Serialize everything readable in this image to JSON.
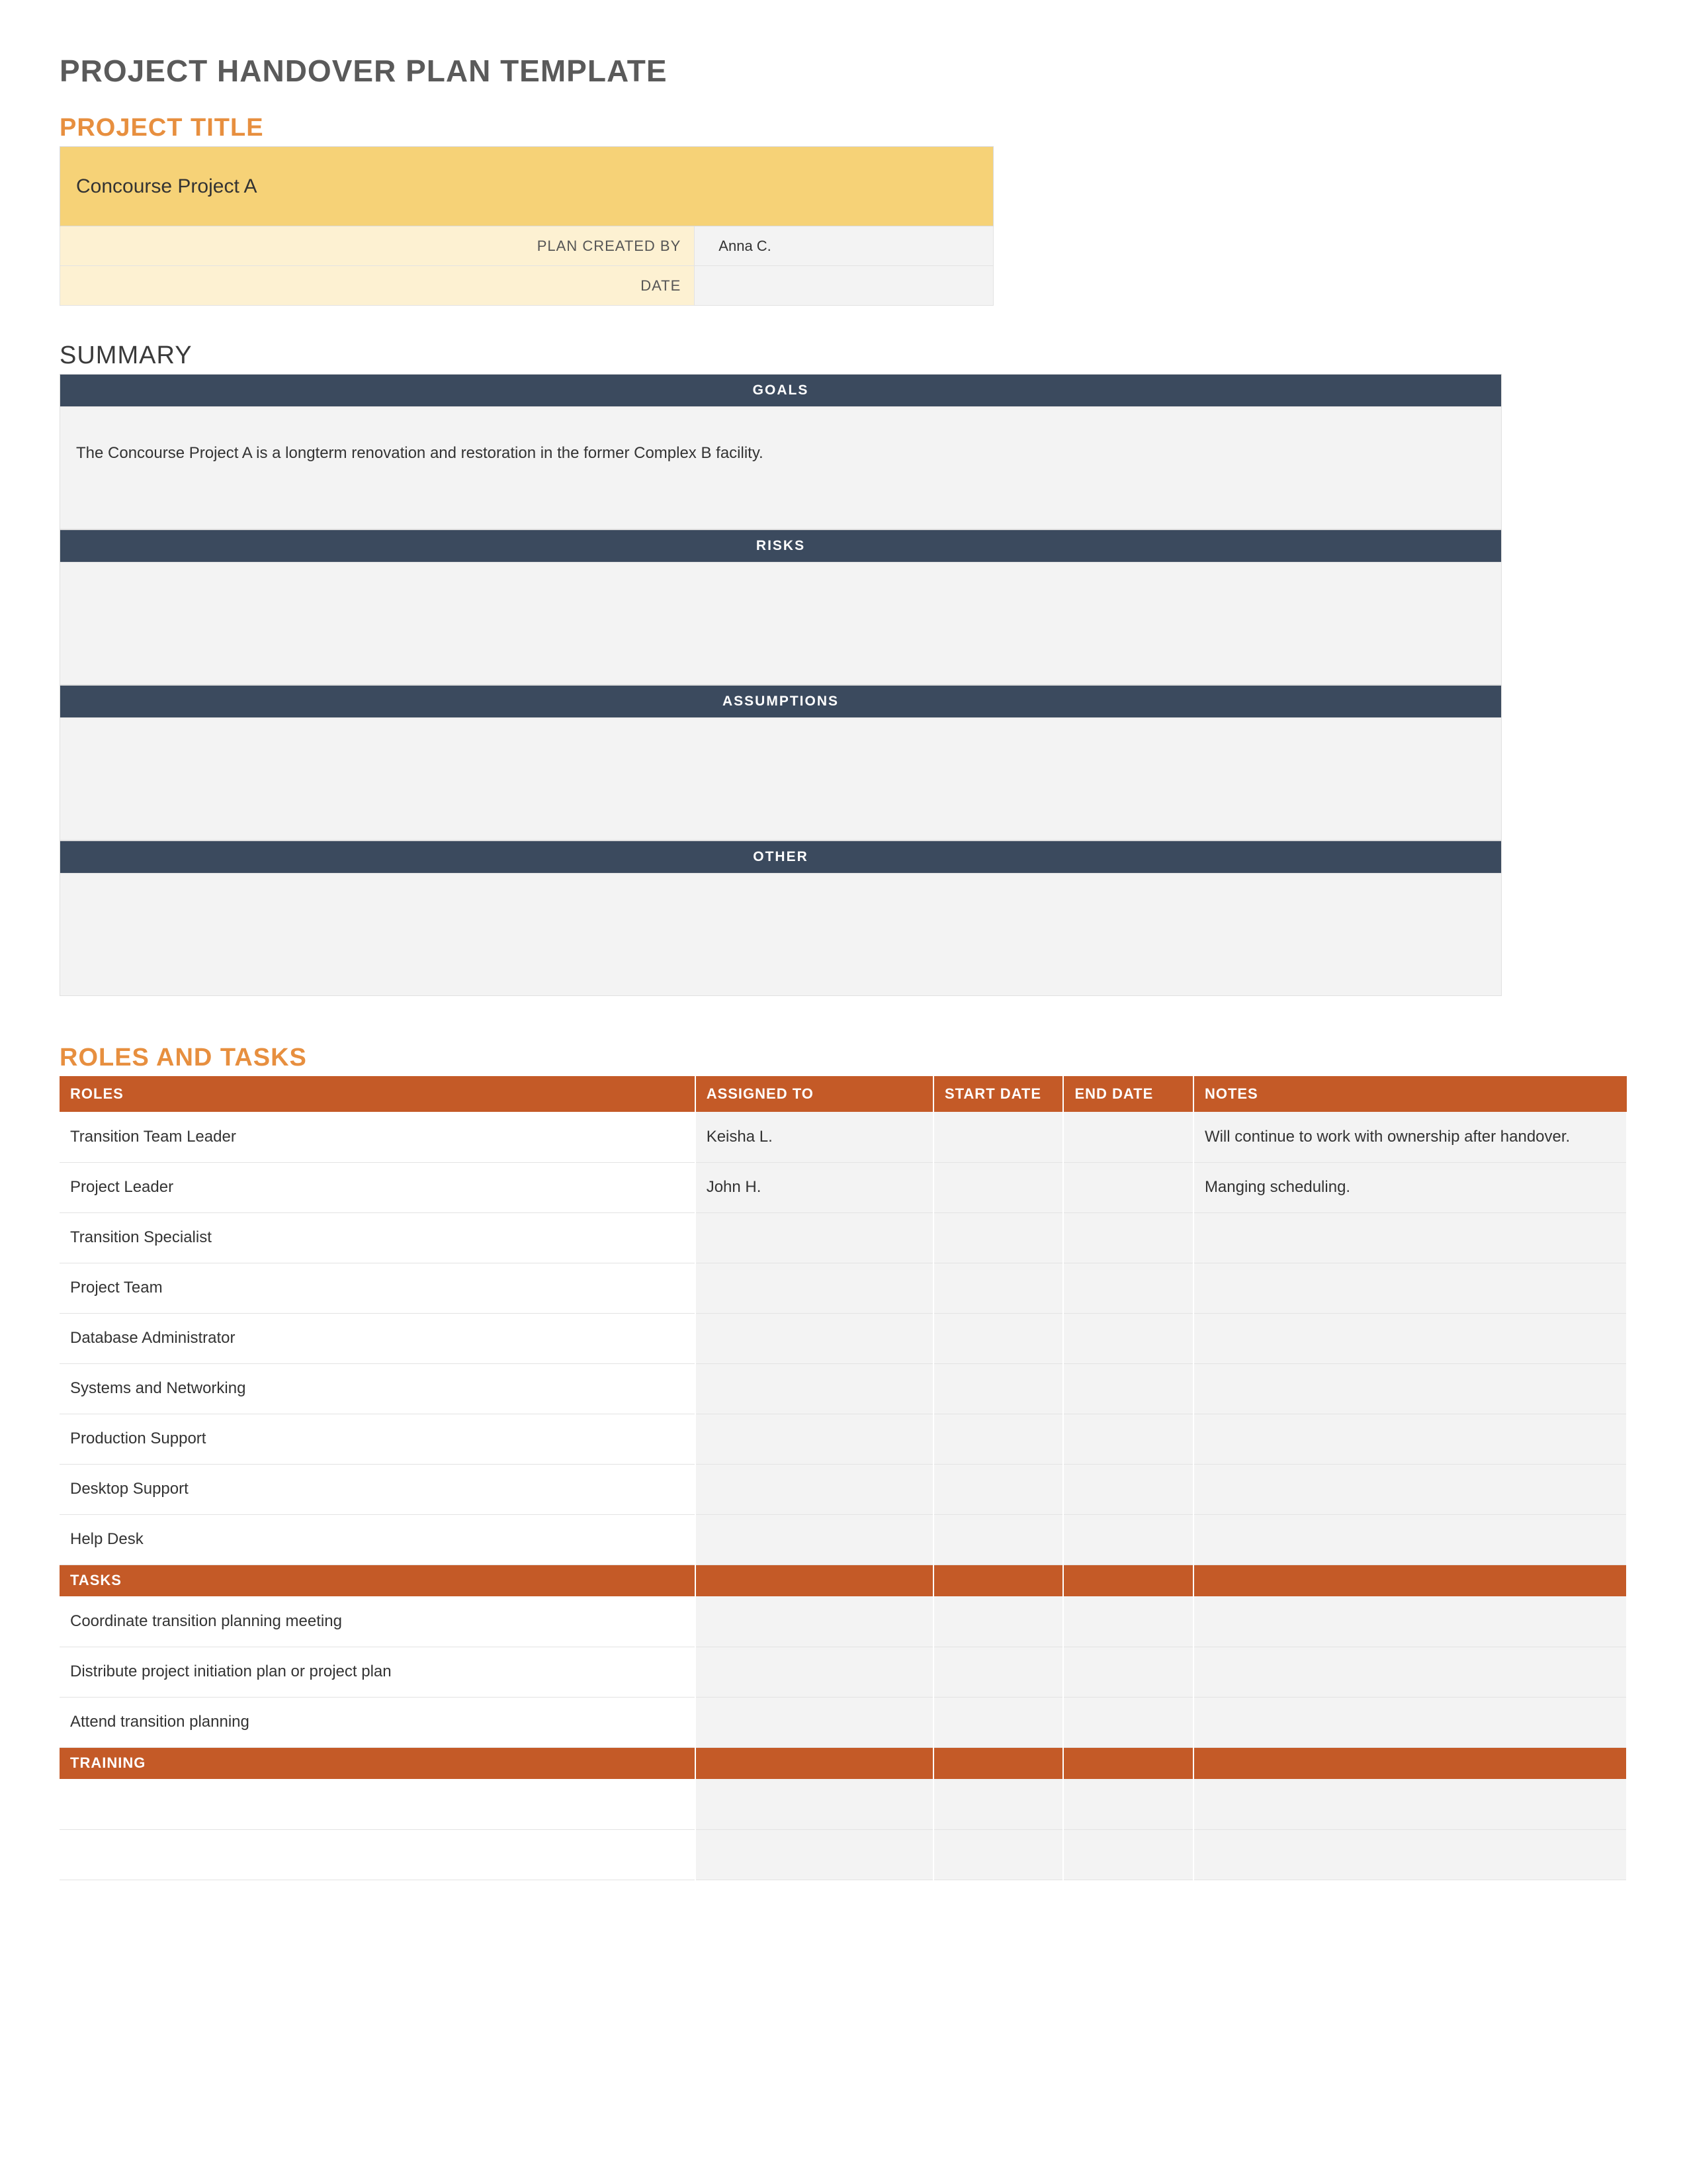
{
  "doc_title": "PROJECT HANDOVER PLAN TEMPLATE",
  "project_title_section": {
    "heading": "PROJECT TITLE",
    "project_name": "Concourse Project A",
    "created_by_label": "PLAN CREATED BY",
    "created_by_value": "Anna C.",
    "date_label": "DATE",
    "date_value": ""
  },
  "summary": {
    "heading": "SUMMARY",
    "goals_label": "GOALS",
    "goals_body": "The Concourse Project A is a longterm renovation and restoration in the former Complex B facility.",
    "risks_label": "RISKS",
    "risks_body": "",
    "assumptions_label": "ASSUMPTIONS",
    "assumptions_body": "",
    "other_label": "OTHER",
    "other_body": ""
  },
  "roles_tasks": {
    "heading": "ROLES AND TASKS",
    "columns": {
      "roles": "ROLES",
      "assigned": "ASSIGNED TO",
      "start": "START DATE",
      "end": "END DATE",
      "notes": "NOTES"
    },
    "roles": [
      {
        "role": "Transition Team Leader",
        "assigned": "Keisha L.",
        "start": "",
        "end": "",
        "notes": "Will continue to work with ownership after handover."
      },
      {
        "role": "Project Leader",
        "assigned": "John H.",
        "start": "",
        "end": "",
        "notes": "Manging scheduling."
      },
      {
        "role": "Transition Specialist",
        "assigned": "",
        "start": "",
        "end": "",
        "notes": ""
      },
      {
        "role": "Project Team",
        "assigned": "",
        "start": "",
        "end": "",
        "notes": ""
      },
      {
        "role": "Database Administrator",
        "assigned": "",
        "start": "",
        "end": "",
        "notes": ""
      },
      {
        "role": "Systems and Networking",
        "assigned": "",
        "start": "",
        "end": "",
        "notes": ""
      },
      {
        "role": "Production Support",
        "assigned": "",
        "start": "",
        "end": "",
        "notes": ""
      },
      {
        "role": "Desktop Support",
        "assigned": "",
        "start": "",
        "end": "",
        "notes": ""
      },
      {
        "role": "Help Desk",
        "assigned": "",
        "start": "",
        "end": "",
        "notes": ""
      }
    ],
    "tasks_label": "TASKS",
    "tasks": [
      {
        "role": "Coordinate transition planning meeting",
        "assigned": "",
        "start": "",
        "end": "",
        "notes": ""
      },
      {
        "role": "Distribute project initiation plan or project plan",
        "assigned": "",
        "start": "",
        "end": "",
        "notes": ""
      },
      {
        "role": "Attend transition planning",
        "assigned": "",
        "start": "",
        "end": "",
        "notes": ""
      }
    ],
    "training_label": "TRAINING",
    "training": [
      {
        "role": "",
        "assigned": "",
        "start": "",
        "end": "",
        "notes": ""
      },
      {
        "role": "",
        "assigned": "",
        "start": "",
        "end": "",
        "notes": ""
      }
    ]
  }
}
